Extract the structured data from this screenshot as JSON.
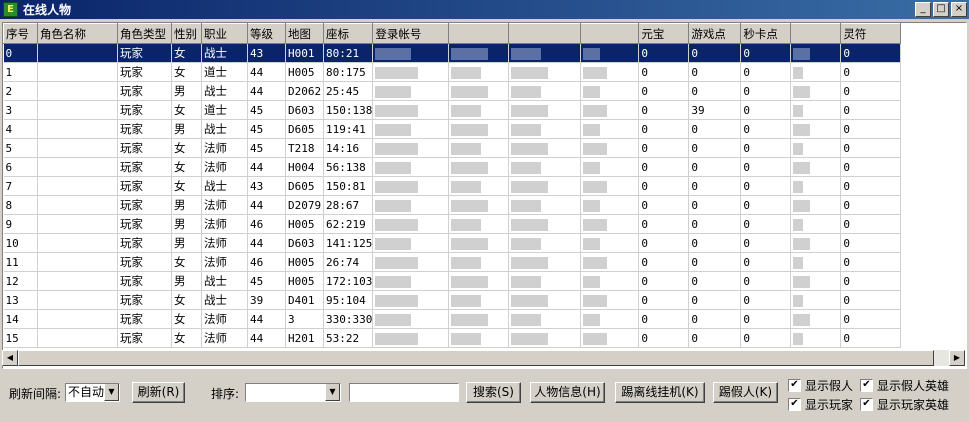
{
  "window": {
    "title": "在线人物",
    "icon_letter": "E",
    "minimize": "_",
    "maximize": "□",
    "close": "×"
  },
  "table": {
    "columns": [
      "序号",
      "角色名称",
      "角色类型",
      "性别",
      "职业",
      "等级",
      "地图",
      "座标",
      "登录帐号",
      "",
      "",
      "",
      "元宝",
      "游戏点",
      "秒卡点",
      "",
      "灵符"
    ],
    "rows": [
      {
        "no": "0",
        "type": "玩家",
        "sex": "女",
        "job": "战士",
        "level": "43",
        "map": "H001",
        "pos": "80:21",
        "yuanbao": "0",
        "gamepoint": "0",
        "card": "0",
        "lingfu": "0"
      },
      {
        "no": "1",
        "type": "玩家",
        "sex": "女",
        "job": "道士",
        "level": "44",
        "map": "H005",
        "pos": "80:175",
        "yuanbao": "0",
        "gamepoint": "0",
        "card": "0",
        "lingfu": "0"
      },
      {
        "no": "2",
        "type": "玩家",
        "sex": "男",
        "job": "战士",
        "level": "44",
        "map": "D2062",
        "pos": "25:45",
        "yuanbao": "0",
        "gamepoint": "0",
        "card": "0",
        "lingfu": "0"
      },
      {
        "no": "3",
        "type": "玩家",
        "sex": "女",
        "job": "道士",
        "level": "45",
        "map": "D603",
        "pos": "150:138",
        "yuanbao": "0",
        "gamepoint": "39",
        "card": "0",
        "lingfu": "0"
      },
      {
        "no": "4",
        "type": "玩家",
        "sex": "男",
        "job": "战士",
        "level": "45",
        "map": "D605",
        "pos": "119:41",
        "yuanbao": "0",
        "gamepoint": "0",
        "card": "0",
        "lingfu": "0"
      },
      {
        "no": "5",
        "type": "玩家",
        "sex": "女",
        "job": "法师",
        "level": "45",
        "map": "T218",
        "pos": "14:16",
        "yuanbao": "0",
        "gamepoint": "0",
        "card": "0",
        "lingfu": "0"
      },
      {
        "no": "6",
        "type": "玩家",
        "sex": "女",
        "job": "法师",
        "level": "44",
        "map": "H004",
        "pos": "56:138",
        "yuanbao": "0",
        "gamepoint": "0",
        "card": "0",
        "lingfu": "0"
      },
      {
        "no": "7",
        "type": "玩家",
        "sex": "女",
        "job": "战士",
        "level": "43",
        "map": "D605",
        "pos": "150:81",
        "yuanbao": "0",
        "gamepoint": "0",
        "card": "0",
        "lingfu": "0"
      },
      {
        "no": "8",
        "type": "玩家",
        "sex": "男",
        "job": "法师",
        "level": "44",
        "map": "D2079",
        "pos": "28:67",
        "yuanbao": "0",
        "gamepoint": "0",
        "card": "0",
        "lingfu": "0"
      },
      {
        "no": "9",
        "type": "玩家",
        "sex": "男",
        "job": "法师",
        "level": "46",
        "map": "H005",
        "pos": "62:219",
        "yuanbao": "0",
        "gamepoint": "0",
        "card": "0",
        "lingfu": "0"
      },
      {
        "no": "10",
        "type": "玩家",
        "sex": "男",
        "job": "法师",
        "level": "44",
        "map": "D603",
        "pos": "141:125",
        "yuanbao": "0",
        "gamepoint": "0",
        "card": "0",
        "lingfu": "0"
      },
      {
        "no": "11",
        "type": "玩家",
        "sex": "女",
        "job": "法师",
        "level": "46",
        "map": "H005",
        "pos": "26:74",
        "yuanbao": "0",
        "gamepoint": "0",
        "card": "0",
        "lingfu": "0"
      },
      {
        "no": "12",
        "type": "玩家",
        "sex": "男",
        "job": "战士",
        "level": "45",
        "map": "H005",
        "pos": "172:103",
        "yuanbao": "0",
        "gamepoint": "0",
        "card": "0",
        "lingfu": "0"
      },
      {
        "no": "13",
        "type": "玩家",
        "sex": "女",
        "job": "战士",
        "level": "39",
        "map": "D401",
        "pos": "95:104",
        "yuanbao": "0",
        "gamepoint": "0",
        "card": "0",
        "lingfu": "0"
      },
      {
        "no": "14",
        "type": "玩家",
        "sex": "女",
        "job": "法师",
        "level": "44",
        "map": "3",
        "pos": "330:330",
        "yuanbao": "0",
        "gamepoint": "0",
        "card": "0",
        "lingfu": "0"
      },
      {
        "no": "15",
        "type": "玩家",
        "sex": "女",
        "job": "法师",
        "level": "44",
        "map": "H201",
        "pos": "53:22",
        "yuanbao": "0",
        "gamepoint": "0",
        "card": "0",
        "lingfu": "0"
      }
    ],
    "selected_row": 0
  },
  "scrollbar": {
    "left_arrow": "◀",
    "right_arrow": "▶"
  },
  "toolbar": {
    "refresh_interval_label": "刷新间隔:",
    "refresh_interval_value": "不自动",
    "refresh_button": "刷新(R)",
    "sort_label": "排序:",
    "sort_value": "",
    "search_value": "",
    "search_button": "搜索(S)",
    "info_button": "人物信息(H)",
    "kick_offline_button": "踢离线挂机(K)",
    "kick_fake_button": "踢假人(K)",
    "combo_arrow": "▼"
  },
  "checkboxes": [
    {
      "label": "显示假人",
      "checked": true
    },
    {
      "label": "显示假人英雄",
      "checked": true
    },
    {
      "label": "显示玩家",
      "checked": true
    },
    {
      "label": "显示玩家英雄",
      "checked": true
    }
  ],
  "check_mark": "✔",
  "colors": {
    "selection": "#0a246a",
    "titlebar": "#0a246a",
    "face": "#d4d0c8"
  }
}
